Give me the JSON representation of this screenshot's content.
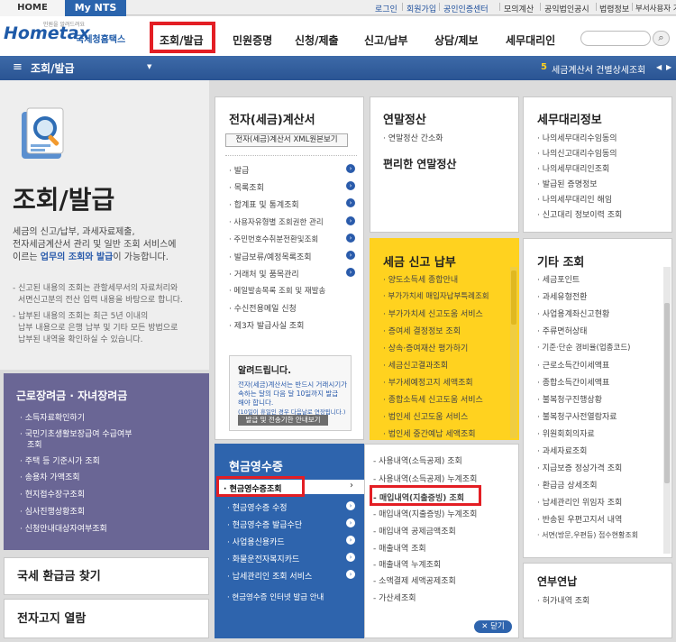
{
  "topbar": {
    "home": "HOME",
    "mynts": "My NTS",
    "links": [
      "로그인",
      "회원가입",
      "공인인증센터",
      "모의계산",
      "공익법인공시",
      "법령정보",
      "부서사용자 가입하기"
    ]
  },
  "header": {
    "logo_small": "민원을 알려드려요",
    "logo_text": "Hometax",
    "logo_sub": "국세청홈택스",
    "gnb": [
      "조회/발급",
      "민원증명",
      "신청/제출",
      "신고/납부",
      "상담/제보",
      "세무대리인"
    ],
    "search_icon": "search-icon"
  },
  "subbar": {
    "menu_icon": "hamburger-icon",
    "title": "조회/발급",
    "notice_num": "5",
    "notice_text": "세금계산서 건별상세조회",
    "nav": [
      "◀",
      "▶"
    ]
  },
  "left": {
    "big_title": "조회/발급",
    "desc": [
      "세금의 신고/납부, 과세자료제출,",
      "전자세금계산서 관리 및 일반 조회 서비스에",
      "이르는 ",
      "업무의 조회와 발급",
      "이 가능합니다."
    ],
    "notes": [
      "- 신고된 내용의 조회는 관할세무서의 자료처리와",
      "서면신고분의 전산 입력 내용을 바탕으로 합니다.",
      "- 납부된 내용의 조회는 최근 5년 이내의",
      "납부 내용으로 은행 납부 및 기타 모든 방법으로",
      "납부된 내역을 확인하실 수 있습니다."
    ]
  },
  "labor": {
    "title": "근로장려금 · 자녀장려금",
    "items": [
      "소득자료확인하기",
      "국민기초생활보장급여 수급여부",
      "조회",
      "주택 등 기준시가 조회",
      "송용차 가액조회",
      "현지접수장구조회",
      "심사진행상황조회",
      "신청안내대상자여부조회"
    ]
  },
  "refund": "국세 환급금 찾기",
  "etax_notice": "전자고지 열람",
  "einvoice": {
    "title": "전자(세금)계산서",
    "xml_btn": "전자(세금)계산서 XML원본보기",
    "items": [
      "발급",
      "목록조회",
      "합계표 및 통계조회",
      "사용자유형별 조회권한 관리",
      "주민번호수취분전환및조회",
      "발급보류/예정목록조회",
      "거래처 및 품목관리",
      "메일발송목록 조회 및 재발송",
      "수신전용메일 신청",
      "제3자 발급사실 조회"
    ],
    "notice_title": "알려드립니다.",
    "notice_lines": [
      "전자(세금)계산서는 반드시 거래시기가",
      "속하는 달의 다음 달 10일까지 발급",
      "해야 합니다.",
      "(10일이 휴일인 경우 다음날로 연장됩니다.)"
    ],
    "notice_btn": "발급 및 전송기한 안내보기"
  },
  "yearend": {
    "title": "연말정산",
    "items": [
      "연말정산 간소화"
    ],
    "sub": "편리한 연말정산"
  },
  "agent": {
    "title": "세무대리정보",
    "items": [
      "나의세무대리수임동의",
      "나의신고대리수임동의",
      "나의세무대리인조회",
      "발급된 증명정보",
      "나의세무대리인 해임",
      "신고대리 정보이력 조회"
    ]
  },
  "taxreport": {
    "title": "세금 신고 납부",
    "items": [
      "양도소득세 종합안내",
      "부가가치세 매입자납부특례조회",
      "부가가치세 신고도움 서비스",
      "증여세 결정정보 조회",
      "상속·증여재산 평가하기",
      "세금신고결과조회",
      "부가세예정고지 세액조회",
      "종합소득세 신고도움 서비스",
      "법인세 신고도움 서비스",
      "법인세 중간예납 세액조회"
    ]
  },
  "other": {
    "title": "기타 조회",
    "items": [
      "세금포인트",
      "과세유형전환",
      "사업용계좌신고현황",
      "주류면허상태",
      "기준·단순 경비율(업종코드)",
      "근로소득간이세액표",
      "종합소득간이세액표",
      "불복청구진행상황",
      "불복청구사전열람자료",
      "위원회회의자료",
      "과세자료조회",
      "지급보증 정상가격 조회",
      "환급금 상세조회",
      "납세관리인 위임자 조회",
      "반송된 우편고지서 내역",
      "서면(방문,우편등) 접수현황조회"
    ]
  },
  "cash": {
    "title": "현금영수증",
    "items": [
      "현금영수증조회",
      "현금영수증 수정",
      "현금영수증 발급수단",
      "사업용신용카드",
      "화물운전자복지카드",
      "납세관리인 조회 서비스",
      "현금영수증 인터넷 발급 안내"
    ],
    "sub_items": [
      "사용내역(소득공제) 조회",
      "사용내역(소득공제) 누계조회",
      "매입내역(지출증빙) 조회",
      "매입내역(지출증빙) 누계조회",
      "매입내역 공제금액조회",
      "매출내역 조회",
      "매출내역 누계조회",
      "소액결제 세액공제조회",
      "가산세조회"
    ],
    "close": "✕ 닫기"
  },
  "pension": {
    "title": "연부연납",
    "items": [
      "허가내역 조회"
    ]
  },
  "colors": {
    "primary": "#2a5493",
    "accent_red": "#e31e24",
    "tax_yellow": "#ffd21f",
    "labor_purple": "#6a6695"
  }
}
